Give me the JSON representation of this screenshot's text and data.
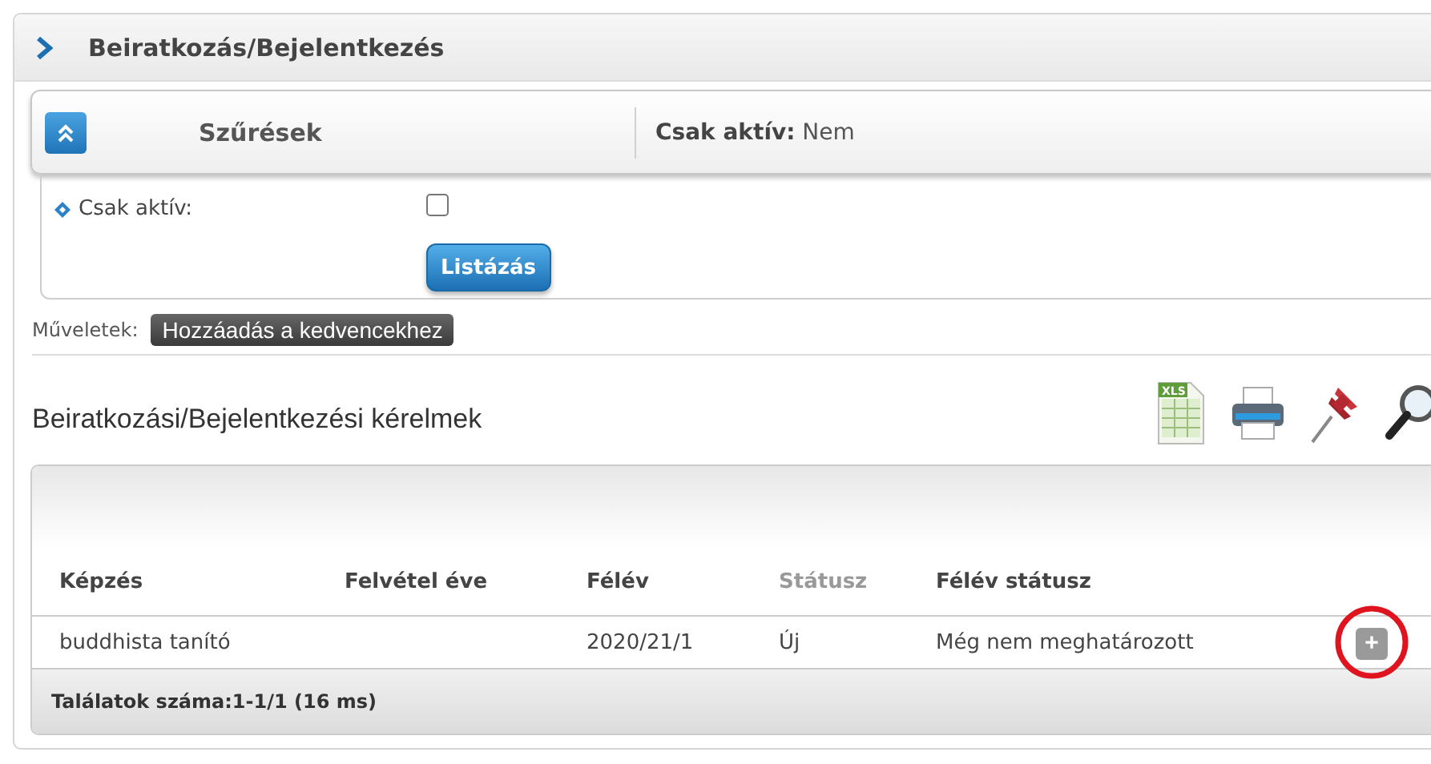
{
  "page_title": "Beiratkozás/Bejelentkezés",
  "filters": {
    "title": "Szűrések",
    "expanded": true,
    "summary_label": "Csak aktív:",
    "summary_value": "Nem",
    "fields": [
      {
        "label": "Csak aktív:",
        "checked": false
      }
    ],
    "submit": "Listázás"
  },
  "operations": {
    "label": "Műveletek:",
    "buttons": [
      "Hozzáadás a kedvencekhez"
    ]
  },
  "section_title": "Beiratkozási/Bejelentkezési kérelmek",
  "toolbar": [
    {
      "kind": "xls",
      "label": "XLS"
    },
    {
      "kind": "print"
    },
    {
      "kind": "pin"
    },
    {
      "kind": "search"
    }
  ],
  "table": {
    "columns": [
      {
        "label": "Képzés",
        "disabled": false
      },
      {
        "label": "Felvétel éve",
        "disabled": false
      },
      {
        "label": "Félév",
        "disabled": false
      },
      {
        "label": "Státusz",
        "disabled": true
      },
      {
        "label": "Félév státusz",
        "disabled": false
      }
    ],
    "rows": [
      {
        "cells": [
          "buddhista tanító",
          "",
          "2020/21/1",
          "Új",
          "Még nem meghatározott"
        ],
        "action": "+",
        "annotated": true
      }
    ],
    "footer": "Találatok száma:1-1/1 (16 ms)"
  }
}
